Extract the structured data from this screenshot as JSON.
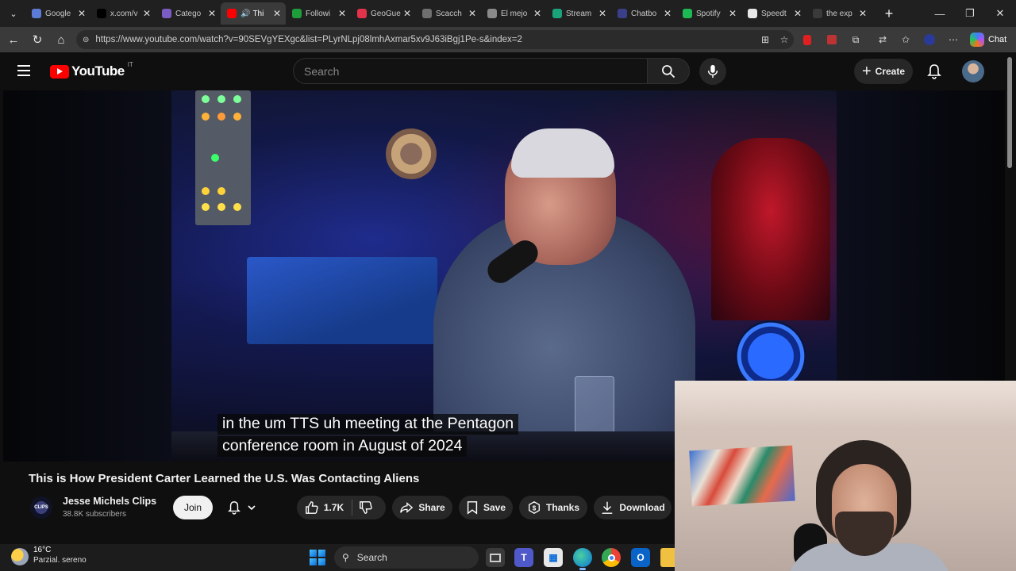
{
  "browser": {
    "tabs": [
      {
        "title": "Google",
        "color": "#5b7bd6",
        "active": false
      },
      {
        "title": "x.com/v",
        "color": "#000000",
        "active": false
      },
      {
        "title": "Catego",
        "color": "#7a5cc4",
        "active": false
      },
      {
        "title": "Thi",
        "color": "#ff0000",
        "active": true
      },
      {
        "title": "Followi",
        "color": "#1f9d3a",
        "active": false
      },
      {
        "title": "GeoGue",
        "color": "#e2334b",
        "active": false
      },
      {
        "title": "Scacch",
        "color": "#6f6f6f",
        "active": false
      },
      {
        "title": "El mejo",
        "color": "#8a8a8a",
        "active": false
      },
      {
        "title": "Stream",
        "color": "#1aa37a",
        "active": false
      },
      {
        "title": "Chatbo",
        "color": "#3b3f8a",
        "active": false
      },
      {
        "title": "Spotify",
        "color": "#1db954",
        "active": false
      },
      {
        "title": "Speedt",
        "color": "#e8e8e8",
        "active": false
      },
      {
        "title": "the exp",
        "color": "#3a3a3a",
        "active": false
      }
    ],
    "address_url": "https://www.youtube.com/watch?v=90SEVgYEXgc&list=PLyrNLpj08lmhAxmar5xv9J63iBgj1Pe-s&index=2",
    "copilot_label": "Chat"
  },
  "youtube": {
    "logo_text": "YouTube",
    "country_code": "IT",
    "search_placeholder": "Search",
    "create_label": "Create"
  },
  "video": {
    "captions": [
      "in the um TTS uh meeting at the Pentagon",
      "conference room in August of 2024"
    ],
    "title": "This is How President Carter Learned the U.S. Was Contacting Aliens",
    "channel_name": "Jesse Michels Clips",
    "channel_avatar_text": "CLIPS",
    "subscribers": "38.8K subscribers",
    "join_label": "Join",
    "likes": "1.7K",
    "share_label": "Share",
    "save_label": "Save",
    "thanks_label": "Thanks",
    "download_label": "Download"
  },
  "taskbar": {
    "temperature": "16°C",
    "weather": "Parzial. sereno",
    "search_label": "Search"
  }
}
